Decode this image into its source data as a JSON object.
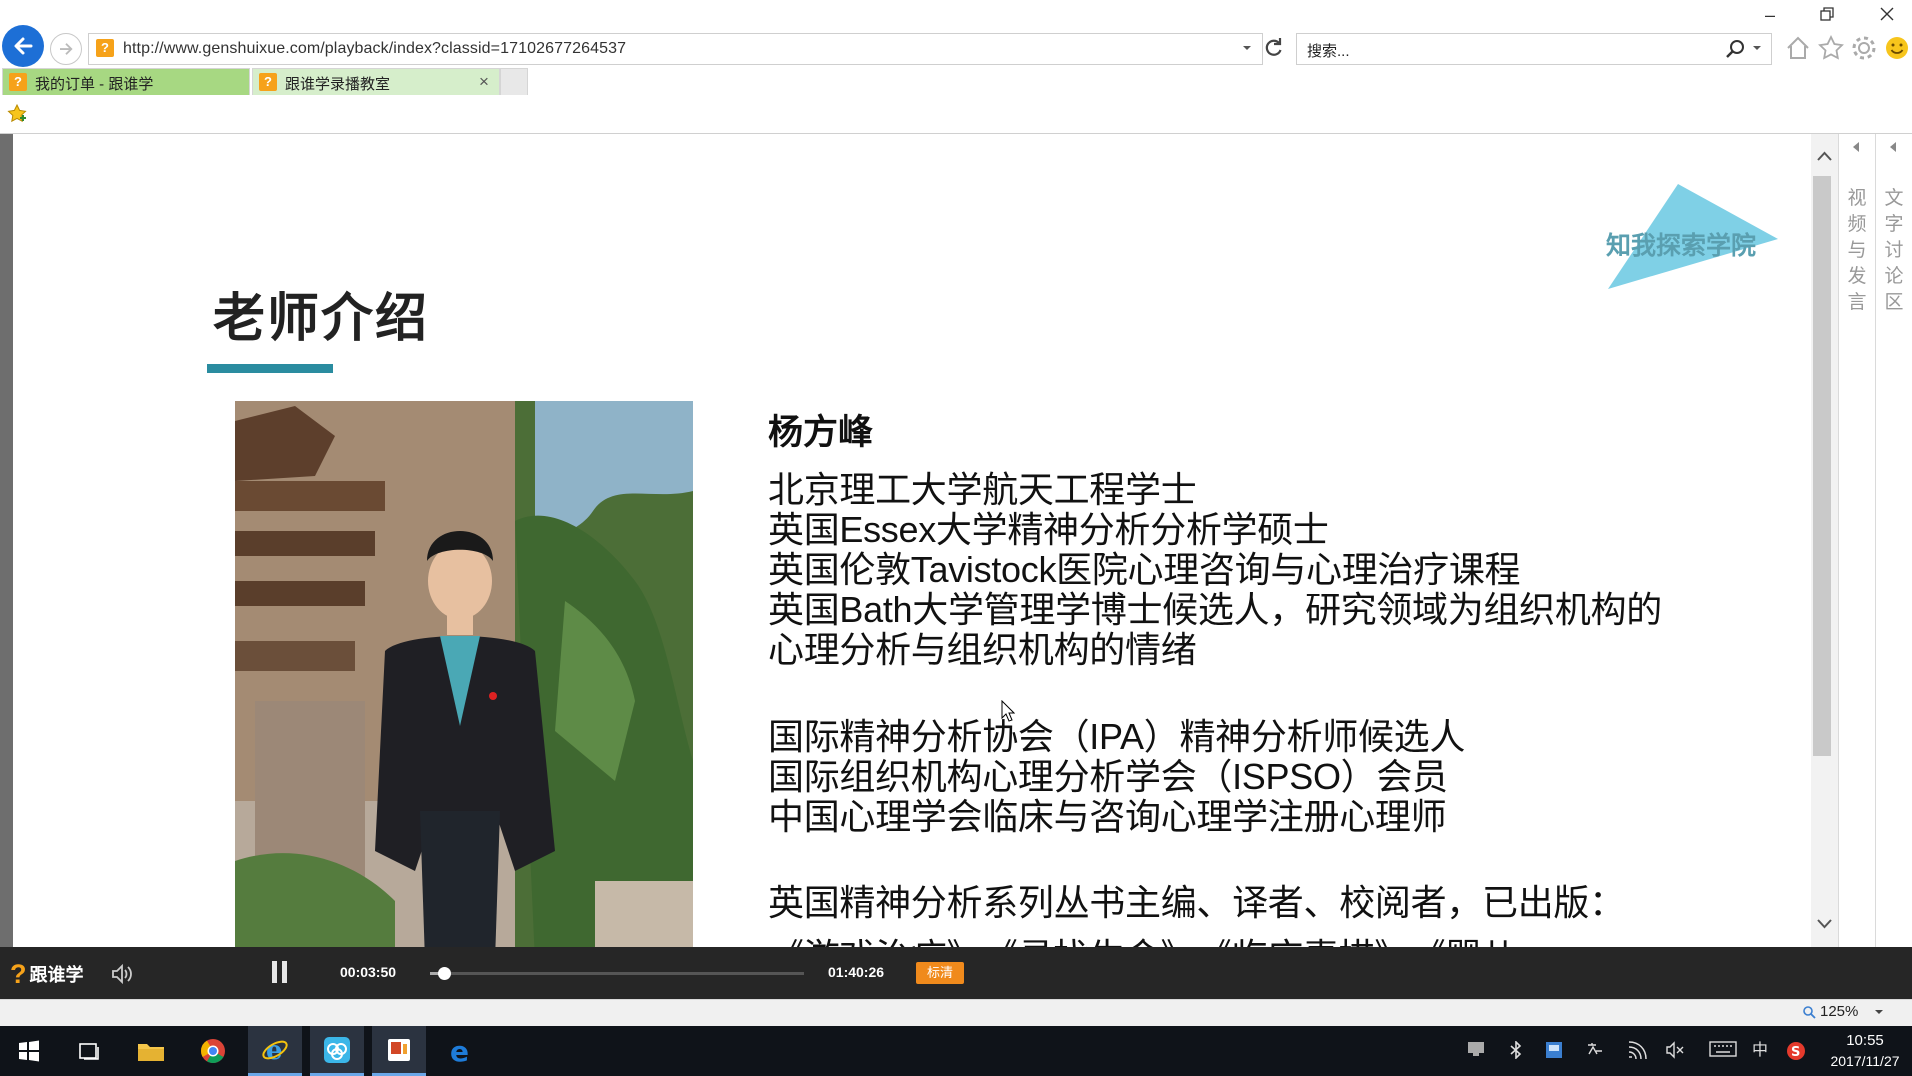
{
  "browser": {
    "url": "http://www.genshuixue.com/playback/index?classid=17102677264537",
    "search_placeholder": "搜索...",
    "tabs": [
      {
        "label": "我的订单 - 跟谁学",
        "active": false
      },
      {
        "label": "跟谁学录播教室",
        "active": true
      }
    ],
    "tab_close": "×"
  },
  "slide": {
    "title": "老师介绍",
    "brand": "知我探索学院",
    "teacher_name": "杨方峰",
    "bio_lines": [
      "北京理工大学航天工程学士",
      "英国Essex大学精神分析分析学硕士",
      "英国伦敦Tavistock医院心理咨询与心理治疗课程",
      "英国Bath大学管理学博士候选人，研究领域为组织机构的",
      "心理分析与组织机构的情绪",
      "国际精神分析协会（IPA）精神分析师候选人",
      "国际组织机构心理分析学会（ISPSO）会员",
      "中国心理学会临床与咨询心理学注册心理师",
      "英国精神分析系列丛书主编、译者、校阅者，已出版："
    ],
    "bio_partial_line": "《游戏治疗》、《寻找生命》、《临床素描》、《婴儿"
  },
  "side_panels": {
    "video": "视频与发言",
    "text": "文字讨论区"
  },
  "player": {
    "logo_mark": "?",
    "logo_text": "跟谁学",
    "current_time": "00:03:50",
    "total_time": "01:40:26",
    "progress_fraction": 0.038,
    "quality_label": "标清"
  },
  "status": {
    "zoom": "125%"
  },
  "taskbar": {
    "time": "10:55",
    "date": "2017/11/27",
    "ime": "中"
  },
  "colors": {
    "accent_teal": "#2a8ca0",
    "brand_orange": "#f6a21a",
    "quality_orange": "#f08a1c",
    "tab_green": "#a7d882"
  }
}
